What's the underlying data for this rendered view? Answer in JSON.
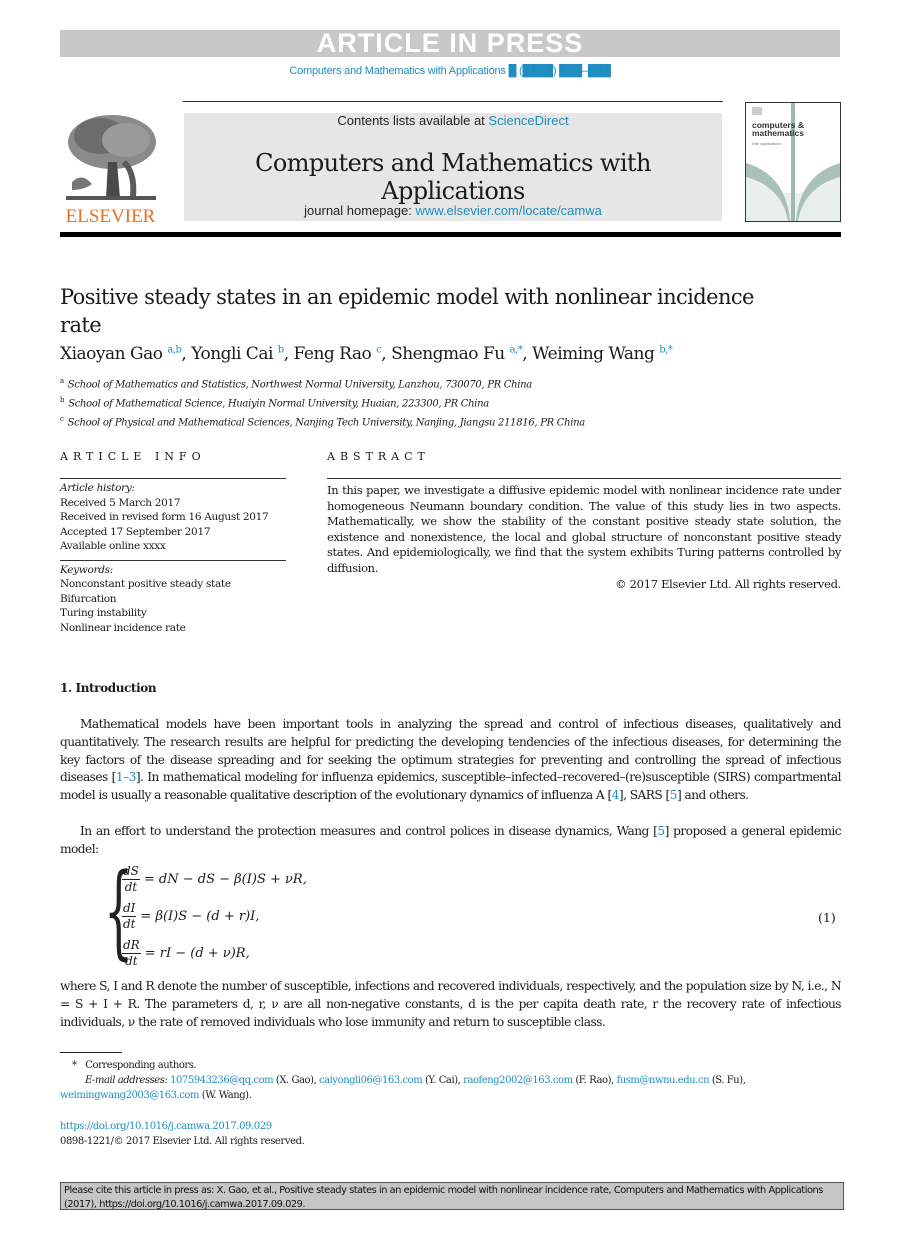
{
  "banner": {
    "label": "ARTICLE IN PRESS"
  },
  "running_header": {
    "journal_ref": "Computers and Mathematics with Applications █ (████) ███–███"
  },
  "publisher": {
    "logo_text": "ELSEVIER"
  },
  "masthead": {
    "contents_prefix": "Contents lists available at ",
    "contents_link": "ScienceDirect",
    "journal_title": "Computers and Mathematics with Applications",
    "homepage_prefix": "journal homepage: ",
    "homepage_link": "www.elsevier.com/locate/camwa"
  },
  "cover": {
    "title_line1": "computers &",
    "title_line2": "mathematics",
    "subtitle": "with applications"
  },
  "article": {
    "title": "Positive steady states in an epidemic model with nonlinear incidence rate",
    "authors": [
      {
        "name": "Xiaoyan Gao",
        "sup": "a,b"
      },
      {
        "name": "Yongli Cai",
        "sup": "b"
      },
      {
        "name": "Feng Rao",
        "sup": "c"
      },
      {
        "name": "Shengmao Fu",
        "sup": "a,*"
      },
      {
        "name": "Weiming Wang",
        "sup": "b,*"
      }
    ],
    "affiliations": [
      {
        "mark": "a",
        "text": "School of Mathematics and Statistics, Northwest Normal University, Lanzhou, 730070, PR China"
      },
      {
        "mark": "b",
        "text": "School of Mathematical Science, Huaiyin Normal University, Huaian, 223300, PR China"
      },
      {
        "mark": "c",
        "text": "School of Physical and Mathematical Sciences, Nanjing Tech University, Nanjing, Jiangsu 211816, PR China"
      }
    ]
  },
  "article_info": {
    "heading": "ARTICLE INFO",
    "history_label": "Article history:",
    "history": [
      "Received 5 March 2017",
      "Received in revised form 16 August 2017",
      "Accepted 17 September 2017",
      "Available online xxxx"
    ],
    "keywords_label": "Keywords:",
    "keywords": [
      "Nonconstant positive steady state",
      "Bifurcation",
      "Turing instability",
      "Nonlinear incidence rate"
    ]
  },
  "abstract": {
    "heading": "ABSTRACT",
    "text": "In this paper, we investigate a diffusive epidemic model with nonlinear incidence rate under homogeneous Neumann boundary condition. The value of this study lies in two aspects. Mathematically, we show the stability of the constant positive steady state solution, the existence and nonexistence, the local and global structure of nonconstant positive steady states. And epidemiologically, we find that the system exhibits Turing patterns controlled by diffusion.",
    "copyright": "© 2017 Elsevier Ltd. All rights reserved."
  },
  "introduction": {
    "heading": "1.  Introduction",
    "p1_a": "Mathematical models have been important tools in analyzing the spread and control of infectious diseases, qualitatively and quantitatively. The research results are helpful for predicting the developing tendencies of the infectious diseases, for determining the key factors of the disease spreading and for seeking the optimum strategies for preventing and controlling the spread of infectious diseases [",
    "p1_ref1": "1–3",
    "p1_b": "]. In mathematical modeling for influenza epidemics, susceptible–infected–recovered–(re)susceptible (SIRS) compartmental model is usually a reasonable qualitative description of the evolutionary dynamics of influenza A [",
    "p1_ref2": "4",
    "p1_c": "], SARS [",
    "p1_ref3": "5",
    "p1_d": "] and others.",
    "p2_a": "In an effort to understand the protection measures and control polices in disease dynamics, Wang [",
    "p2_ref": "5",
    "p2_b": "] proposed a general epidemic model:",
    "equations": [
      {
        "num": "dS",
        "den": "dt",
        "rhs": "= dN − dS − β(I)S + νR,"
      },
      {
        "num": "dI",
        "den": "dt",
        "rhs": "= β(I)S − (d + r)I,"
      },
      {
        "num": "dR",
        "den": "dt",
        "rhs": "= rI − (d + ν)R,"
      }
    ],
    "equation_number": "(1)",
    "p3": "where S, I and R denote the number of susceptible, infections and recovered individuals, respectively, and the population size by N, i.e., N = S + I + R. The parameters d, r, ν are all non-negative constants, d is the per capita death rate, r the recovery rate of infectious individuals, ν the rate of removed individuals who lose immunity and return to susceptible class."
  },
  "footnotes": {
    "corresponding_mark": "*",
    "corresponding_text": "Corresponding authors.",
    "email_label": "E-mail addresses:",
    "emails": [
      {
        "address": "1075943236@qq.com",
        "owner": "(X. Gao),"
      },
      {
        "address": "caiyongli06@163.com",
        "owner": "(Y. Cai),"
      },
      {
        "address": "raofeng2002@163.com",
        "owner": "(F. Rao),"
      },
      {
        "address": "fusm@nwnu.edu.cn",
        "owner": "(S. Fu),"
      },
      {
        "address": "weimingwang2003@163.com",
        "owner": "(W. Wang)."
      }
    ],
    "doi": "https://doi.org/10.1016/j.camwa.2017.09.029",
    "issn_line": "0898-1221/© 2017 Elsevier Ltd. All rights reserved."
  },
  "citation_box": {
    "text": "Please cite this article in press as: X. Gao, et al., Positive steady states in an epidemic model with nonlinear incidence rate, Computers and Mathematics with Applications (2017), https://doi.org/10.1016/j.camwa.2017.09.029."
  },
  "colors": {
    "link": "#1f8dbf",
    "elsevier_orange": "#e9711c",
    "banner_gray": "#c8c8c8",
    "masthead_gray": "#e6e6e6"
  }
}
